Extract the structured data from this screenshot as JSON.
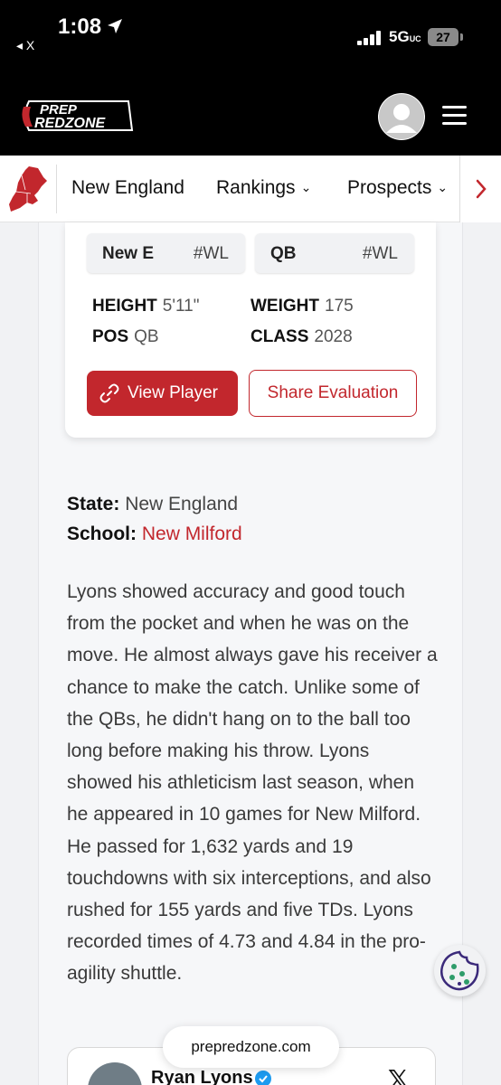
{
  "status_bar": {
    "time": "1:08",
    "back_app": "◂ X",
    "network": "5G",
    "network_sub": "UC",
    "battery": "27"
  },
  "header": {
    "logo_line1": "PREP",
    "logo_line2": "REDZONE"
  },
  "nav": {
    "items": [
      {
        "label": "New England"
      },
      {
        "label": "Rankings",
        "has_dropdown": true
      },
      {
        "label": "Prospects",
        "has_dropdown": true
      }
    ]
  },
  "player_card": {
    "ranks": [
      {
        "label": "New E",
        "value": "#WL"
      },
      {
        "label": "QB",
        "value": "#WL"
      }
    ],
    "stats": {
      "height_label": "HEIGHT",
      "height": "5'11\"",
      "weight_label": "WEIGHT",
      "weight": "175",
      "pos_label": "POS",
      "pos": "QB",
      "class_label": "CLASS",
      "class": "2028"
    },
    "view_button": "View Player",
    "share_button": "Share Evaluation"
  },
  "meta": {
    "state_label": "State:",
    "state": "New England",
    "school_label": "School:",
    "school": "New Milford"
  },
  "evaluation_text": "Lyons showed accuracy and good touch from the pocket and when he was on the move. He almost always gave his receiver a chance to make the catch. Unlike some of the QBs, he didn't hang on to the ball too long before making his throw. Lyons showed his athleticism last season, when he appeared in 10 games for New Milford. He passed for 1,632 yards and 19 touchdowns with six interceptions, and also rushed for 155 yards and five TDs. Lyons recorded times of 4.73 and 4.84 in the pro-agility shuttle.",
  "tweet": {
    "author": "Ryan Lyons"
  },
  "url_pill": "prepredzone.com",
  "colors": {
    "brand_red": "#c2272d",
    "header_bg": "#000000"
  }
}
